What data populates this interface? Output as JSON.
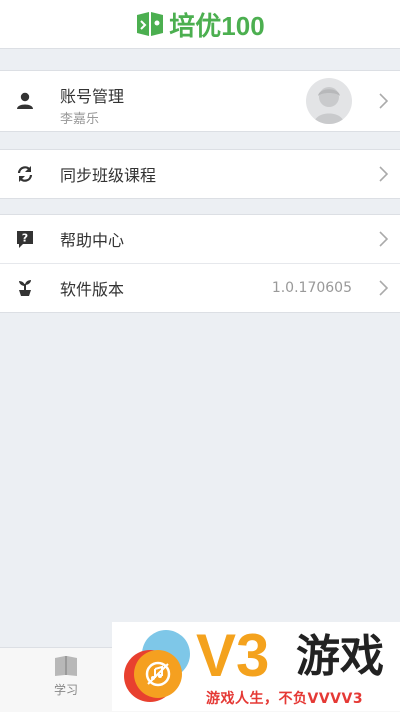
{
  "app": {
    "logo_text": "培优100",
    "brand_color": "#4caf50"
  },
  "menu": {
    "account": {
      "label": "账号管理",
      "username": "李嘉乐"
    },
    "sync": {
      "label": "同步班级课程"
    },
    "help": {
      "label": "帮助中心"
    },
    "version": {
      "label": "软件版本",
      "value": "1.0.170605"
    }
  },
  "tabbar": {
    "study_label": "学习"
  },
  "ad": {
    "brand": "V3",
    "title": "游戏",
    "slogan": "游戏人生，不负VVVV3"
  },
  "icons": {
    "user": "person-icon",
    "sync": "sync-icon",
    "help": "help-icon",
    "version": "plant-icon",
    "chevron": "chevron-right-icon",
    "study": "book-icon"
  }
}
